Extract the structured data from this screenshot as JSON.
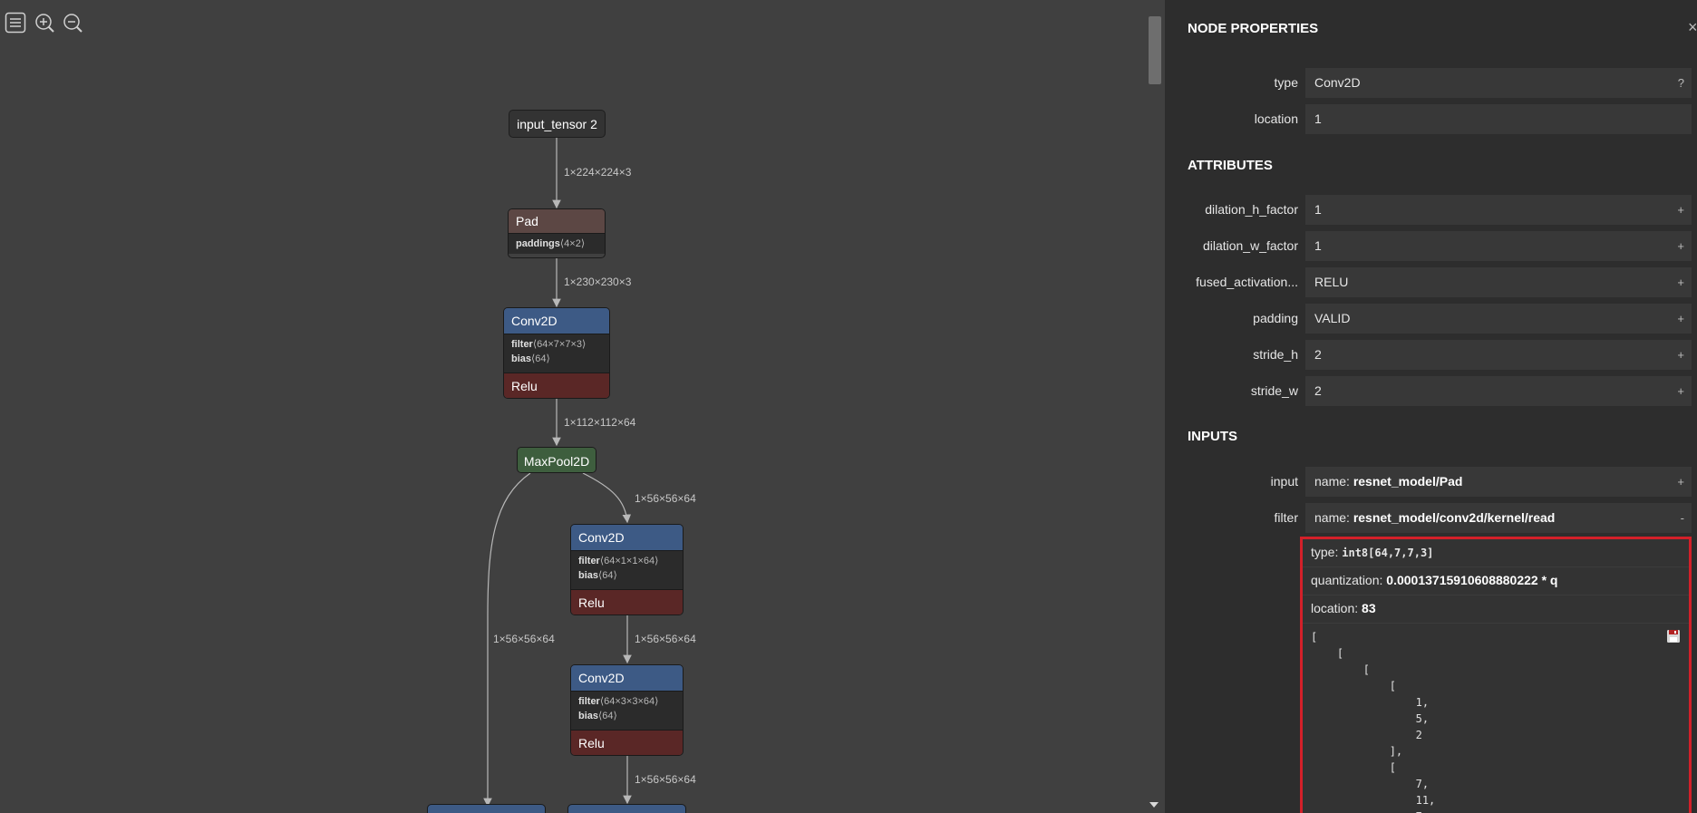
{
  "nodes": {
    "input": {
      "label": "input_tensor 2"
    },
    "pad": {
      "label": "Pad",
      "attr_name": "paddings",
      "attr_value": "⟨4×2⟩"
    },
    "conv1": {
      "label": "Conv2D",
      "filter_name": "filter",
      "filter_value": "⟨64×7×7×3⟩",
      "bias_name": "bias",
      "bias_value": "⟨64⟩",
      "activation": "Relu"
    },
    "maxpool": {
      "label": "MaxPool2D"
    },
    "conv2": {
      "label": "Conv2D",
      "filter_name": "filter",
      "filter_value": "⟨64×1×1×64⟩",
      "bias_name": "bias",
      "bias_value": "⟨64⟩",
      "activation": "Relu"
    },
    "conv3": {
      "label": "Conv2D",
      "filter_name": "filter",
      "filter_value": "⟨64×3×3×64⟩",
      "bias_name": "bias",
      "bias_value": "⟨64⟩",
      "activation": "Relu"
    }
  },
  "edges": {
    "e1": "1×224×224×3",
    "e2": "1×230×230×3",
    "e3": "1×112×112×64",
    "e4": "1×56×56×64",
    "e5": "1×56×56×64",
    "e6": "1×56×56×64",
    "e7": "1×56×56×64"
  },
  "panel": {
    "title": "NODE PROPERTIES",
    "close": "×",
    "type_label": "type",
    "type_value": "Conv2D",
    "type_help": "?",
    "location_label": "location",
    "location_value": "1",
    "attributes_title": "ATTRIBUTES",
    "attributes": [
      {
        "name": "dilation_h_factor",
        "value": "1",
        "btn": "+"
      },
      {
        "name": "dilation_w_factor",
        "value": "1",
        "btn": "+"
      },
      {
        "name": "fused_activation...",
        "value": "RELU",
        "btn": "+"
      },
      {
        "name": "padding",
        "value": "VALID",
        "btn": "+"
      },
      {
        "name": "stride_h",
        "value": "2",
        "btn": "+"
      },
      {
        "name": "stride_w",
        "value": "2",
        "btn": "+"
      }
    ],
    "inputs_title": "INPUTS",
    "inputs": [
      {
        "name": "input",
        "prefix": "name: ",
        "value": "resnet_model/Pad",
        "btn": "+"
      },
      {
        "name": "filter",
        "prefix": "name: ",
        "value": "resnet_model/conv2d/kernel/read",
        "btn": "-"
      }
    ],
    "tensor": {
      "type_prefix": "type: ",
      "type_value": "int8[64,7,7,3]",
      "quant_prefix": "quantization: ",
      "quant_value": "0.00013715910608880222 * q",
      "loc_prefix": "location: ",
      "loc_value": "83",
      "data": "[\n    [\n        [\n            [\n                1,\n                5,\n                2\n            ],\n            [\n                7,\n                11,\n                7,"
    }
  }
}
